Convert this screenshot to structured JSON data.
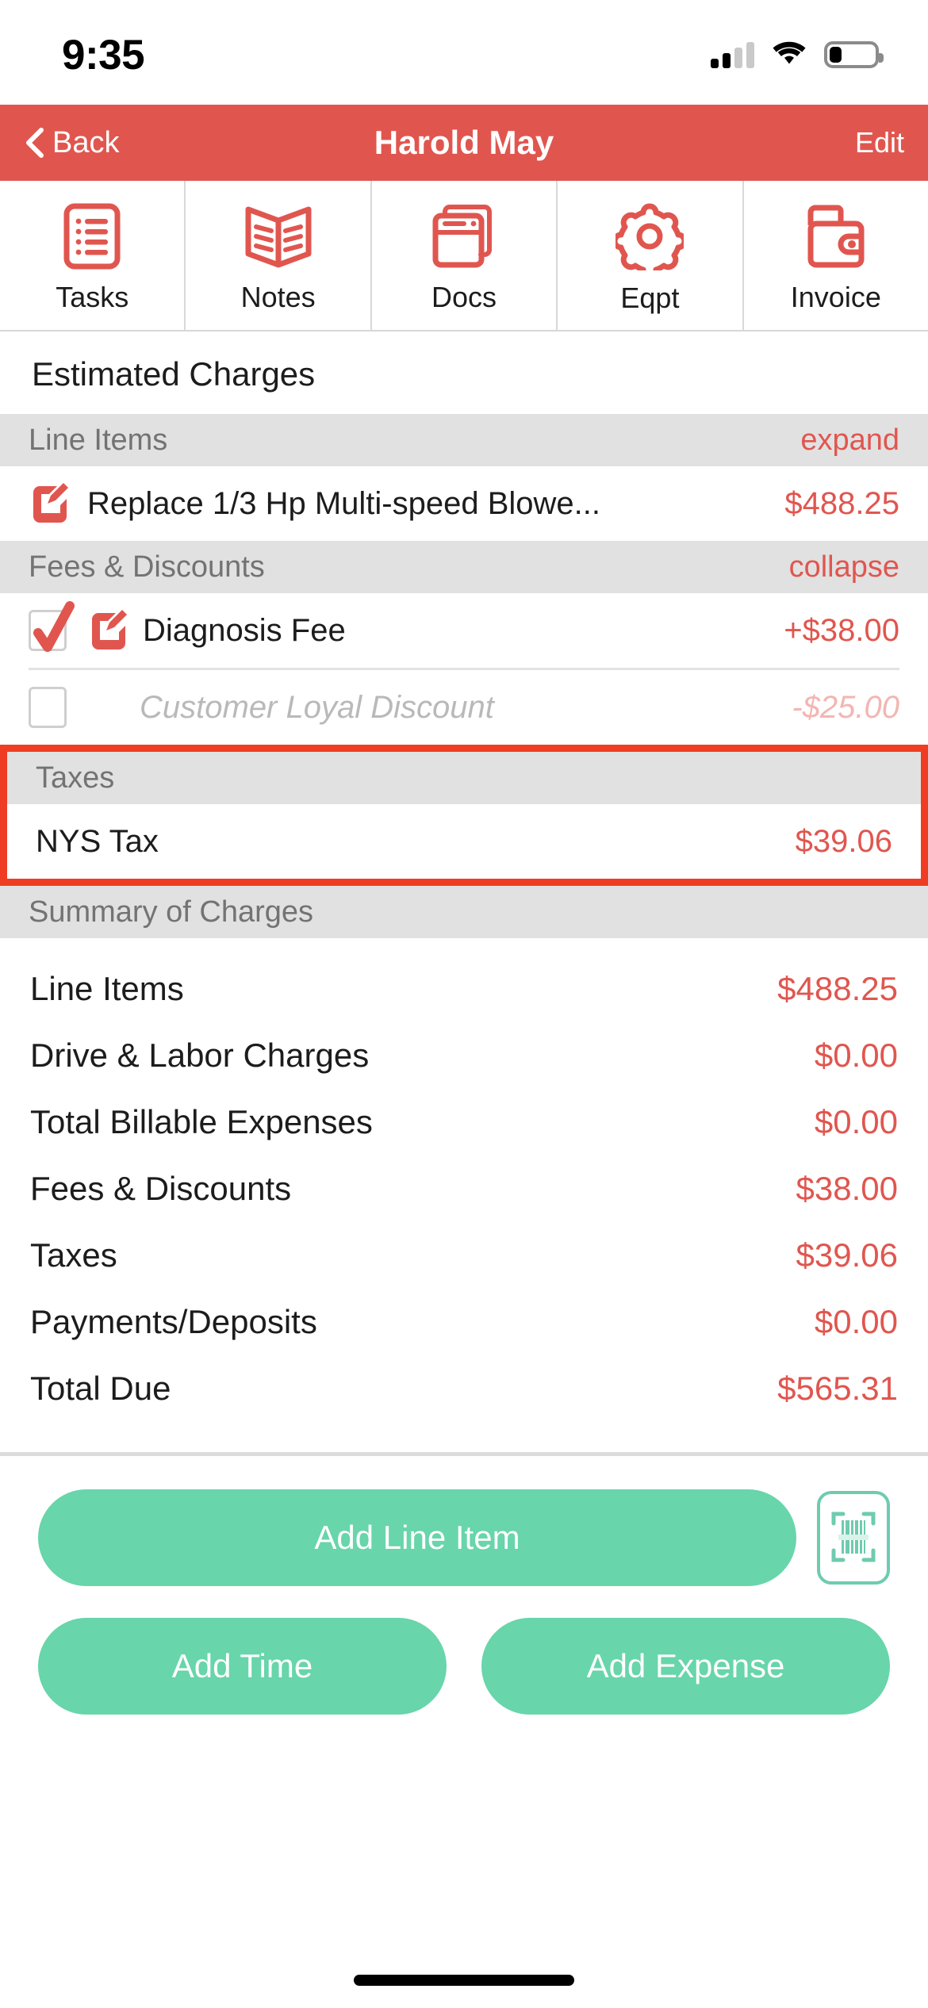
{
  "status_bar": {
    "time": "9:35",
    "icons": [
      "cellular-signal-icon",
      "wifi-icon",
      "battery-icon"
    ]
  },
  "nav_bar": {
    "back_label": "Back",
    "title": "Harold May",
    "edit_label": "Edit",
    "background_color": "#e0564f"
  },
  "tabs": [
    {
      "label": "Tasks",
      "icon": "list-document-icon"
    },
    {
      "label": "Notes",
      "icon": "open-book-icon"
    },
    {
      "label": "Docs",
      "icon": "stacked-documents-icon"
    },
    {
      "label": "Eqpt",
      "icon": "gear-icon"
    },
    {
      "label": "Invoice",
      "icon": "wallet-icon"
    }
  ],
  "page_title": "Estimated Charges",
  "sections": {
    "line_items": {
      "header": "Line Items",
      "action": "expand",
      "rows": [
        {
          "icon": "edit-pencil-icon",
          "label": "Replace 1/3 Hp Multi-speed Blowe...",
          "amount": "$488.25"
        }
      ]
    },
    "fees_discounts": {
      "header": "Fees & Discounts",
      "action": "collapse",
      "rows": [
        {
          "checked": "checked",
          "icon": "edit-pencil-icon",
          "label": "Diagnosis Fee",
          "amount": "+$38.00"
        },
        {
          "checked": "unchecked",
          "icon": "none",
          "label": "Customer Loyal Discount",
          "amount": "-$25.00"
        }
      ]
    },
    "taxes": {
      "header": "Taxes",
      "highlighted": true,
      "highlight_color": "#ee3d23",
      "rows": [
        {
          "label": "NYS Tax",
          "amount": "$39.06"
        }
      ]
    },
    "summary": {
      "header": "Summary of Charges",
      "rows": [
        {
          "label": "Line Items",
          "amount": "$488.25"
        },
        {
          "label": "Drive & Labor Charges",
          "amount": "$0.00"
        },
        {
          "label": "Total Billable Expenses",
          "amount": "$0.00"
        },
        {
          "label": "Fees & Discounts",
          "amount": "$38.00"
        },
        {
          "label": "Taxes",
          "amount": "$39.06"
        },
        {
          "label": "Payments/Deposits",
          "amount": "$0.00"
        },
        {
          "label": "Total Due",
          "amount": "$565.31"
        }
      ]
    }
  },
  "actions": {
    "add_line_item": "Add Line Item",
    "scan_icon": "barcode-scan-icon",
    "add_time": "Add Time",
    "add_expense": "Add Expense",
    "button_color": "#68d5ab"
  }
}
